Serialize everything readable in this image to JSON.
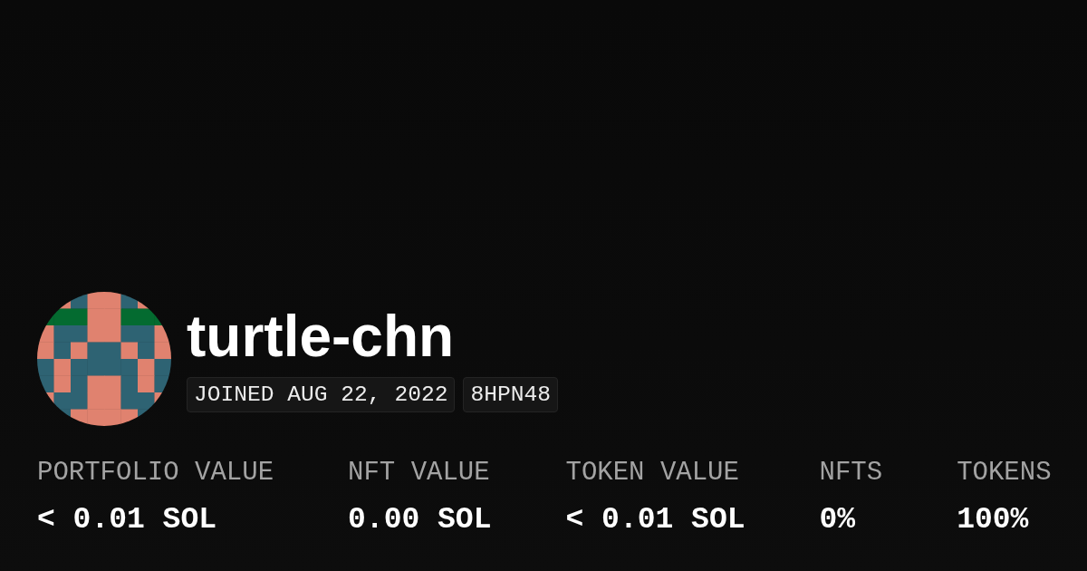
{
  "profile": {
    "username": "turtle-chn",
    "badges": [
      "JOINED AUG 22, 2022",
      "8HPN48"
    ]
  },
  "stats": [
    {
      "label": "PORTFOLIO VALUE",
      "value": "< 0.01 SOL"
    },
    {
      "label": "NFT VALUE",
      "value": "0.00 SOL"
    },
    {
      "label": "TOKEN VALUE",
      "value": "< 0.01 SOL"
    },
    {
      "label": "NFTS",
      "value": "0%"
    },
    {
      "label": "TOKENS",
      "value": "100%"
    }
  ]
}
